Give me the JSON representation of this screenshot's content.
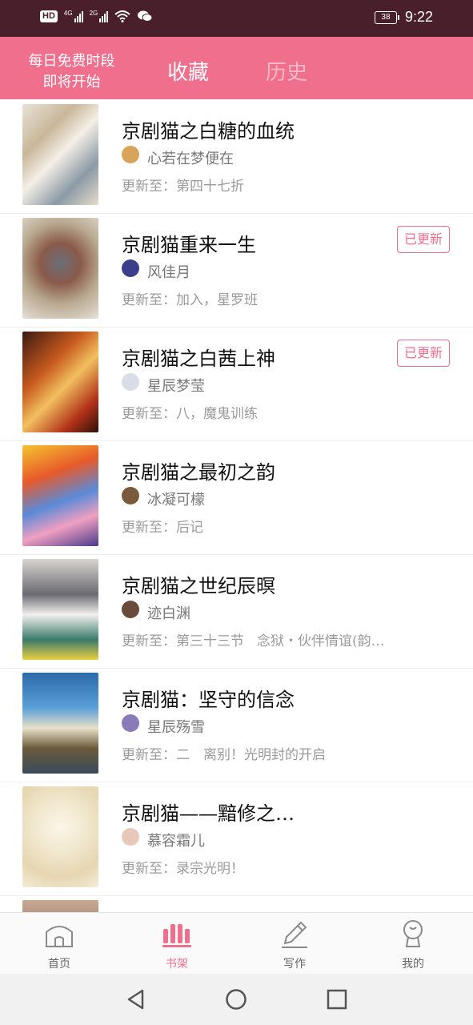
{
  "status_bar": {
    "left_labels": [
      "HD",
      "4G",
      "2G"
    ],
    "battery": "38",
    "time": "9:22"
  },
  "header": {
    "promo_line1": "每日免费时段",
    "promo_line2": "即将开始",
    "tabs": [
      {
        "label": "收藏",
        "active": true
      },
      {
        "label": "历史",
        "active": false
      }
    ],
    "accent_color": "#f06f8d"
  },
  "books": [
    {
      "title": "京剧猫之白糖的血统",
      "author": "心若在梦便在",
      "update": "更新至：第四十七折",
      "update_extra": "",
      "badge": "",
      "cover_icon": "comic-cover-image",
      "avatar_color": "#d9a35c"
    },
    {
      "title": "京剧猫重来一生",
      "author": "风佳月",
      "update": "更新至：加入，星罗班",
      "update_extra": "",
      "badge": "已更新",
      "cover_icon": "comic-cover-image",
      "avatar_color": "#3b3f8a"
    },
    {
      "title": "京剧猫之白茜上神",
      "author": "星辰梦莹",
      "update": "更新至：八，魔鬼训练",
      "update_extra": "",
      "badge": "已更新",
      "cover_icon": "comic-cover-image",
      "avatar_color": "#d8dde8"
    },
    {
      "title": "京剧猫之最初之韵",
      "author": "冰凝可檬",
      "update": "更新至：后记",
      "update_extra": "",
      "badge": "",
      "cover_icon": "comic-cover-image",
      "avatar_color": "#7a5a3a"
    },
    {
      "title": "京剧猫之世纪辰暝",
      "author": "迹白渊",
      "update": "更新至：第三十三节",
      "update_extra": "念狱・伙伴情谊(韵…",
      "badge": "",
      "cover_icon": "comic-cover-image",
      "avatar_color": "#6a4a3a"
    },
    {
      "title": "京剧猫：坚守的信念",
      "author": "星辰殇雪",
      "update": "更新至：二　离别！光明封的开启",
      "update_extra": "",
      "badge": "",
      "cover_icon": "comic-cover-image",
      "avatar_color": "#8a7bb8"
    },
    {
      "title": "京剧猫——黯修之…",
      "author": "慕容霜儿",
      "update": "更新至：录宗光明！",
      "update_extra": "",
      "badge": "",
      "cover_icon": "comic-cover-image",
      "avatar_color": "#e8c8b8"
    }
  ],
  "bottom_nav": [
    {
      "label": "首页",
      "icon": "home-icon",
      "active": false
    },
    {
      "label": "书架",
      "icon": "bookshelf-icon",
      "active": true
    },
    {
      "label": "写作",
      "icon": "pen-icon",
      "active": false
    },
    {
      "label": "我的",
      "icon": "profile-icon",
      "active": false
    }
  ],
  "system_nav": [
    "back-icon",
    "home-circle-icon",
    "recent-apps-icon"
  ]
}
